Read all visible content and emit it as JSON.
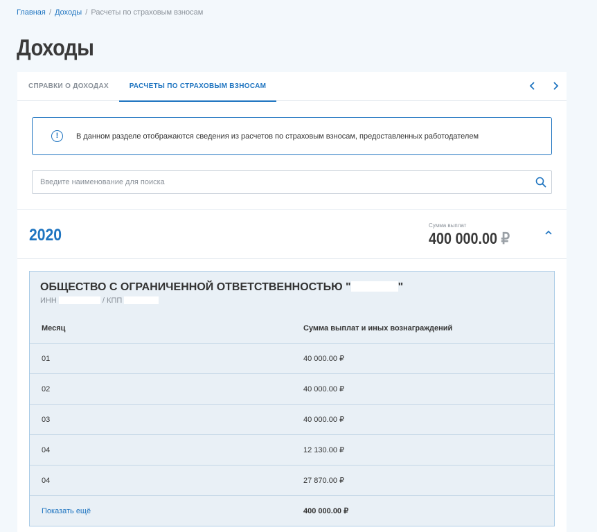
{
  "breadcrumb": {
    "home": "Главная",
    "section": "Доходы",
    "current": "Расчеты по страховым взносам",
    "separator": "/"
  },
  "page_title": "Доходы",
  "tabs": [
    {
      "label": "СПРАВКИ О ДОХОДАХ",
      "active": false
    },
    {
      "label": "РАСЧЕТЫ ПО СТРАХОВЫМ ВЗНОСАМ",
      "active": true
    }
  ],
  "info": {
    "icon": "info-icon",
    "text": "В данном разделе отображаются сведения из расчетов по страховым взносам, предоставленных работодателем"
  },
  "search": {
    "placeholder": "Введите наименование для поиска",
    "value": ""
  },
  "year_section": {
    "year": "2020",
    "sum_label": "Сумма выплат",
    "sum_value": "400 000.00",
    "currency": "₽"
  },
  "organization": {
    "name_prefix": "ОБЩЕСТВО С ОГРАНИЧЕННОЙ ОТВЕТСТВЕННОСТЬЮ \"",
    "name_suffix": "\"",
    "inn_label": "ИНН",
    "kpp_label": "/ КПП"
  },
  "table": {
    "headers": [
      "Месяц",
      "Сумма выплат и иных вознаграждений"
    ],
    "rows": [
      {
        "month": "01",
        "amount": "40 000.00 ₽"
      },
      {
        "month": "02",
        "amount": "40 000.00 ₽"
      },
      {
        "month": "03",
        "amount": "40 000.00 ₽"
      },
      {
        "month": "04",
        "amount": "12 130.00 ₽"
      },
      {
        "month": "04",
        "amount": "27 870.00 ₽"
      }
    ],
    "show_more": "Показать ещё",
    "total": "400 000.00 ₽"
  },
  "colors": {
    "accent": "#1e74c0",
    "background": "#f3f8fc",
    "org_box": "#e9f0f6"
  }
}
